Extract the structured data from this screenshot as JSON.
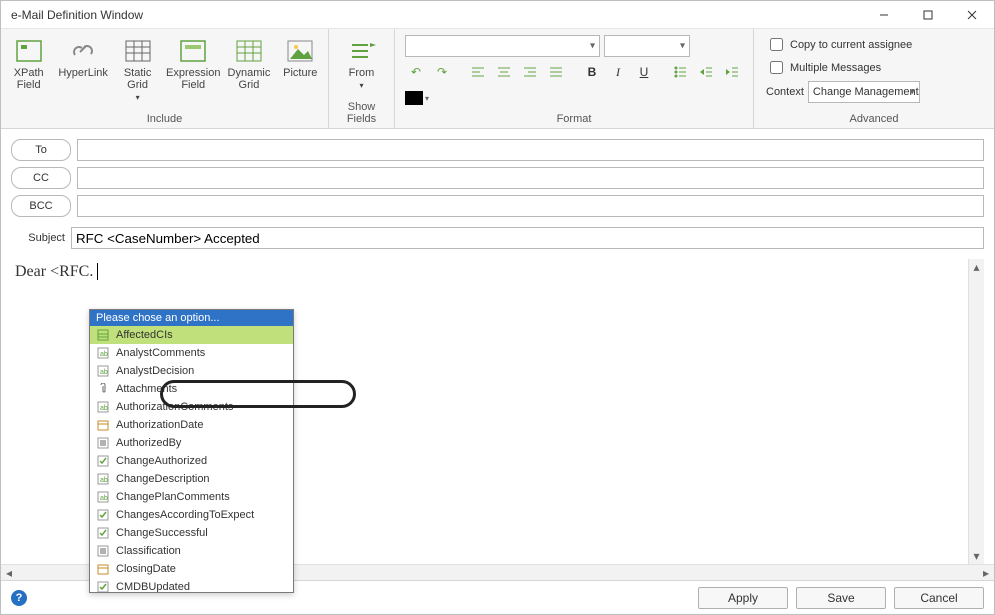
{
  "window": {
    "title": "e-Mail Definition Window"
  },
  "ribbon": {
    "include": {
      "label": "Include",
      "xpath": "XPath\nField",
      "hyperlink": "HyperLink",
      "staticgrid": "Static\nGrid",
      "exprfield": "Expression\nField",
      "dyngrid": "Dynamic\nGrid",
      "picture": "Picture"
    },
    "showfields": {
      "label": "Show Fields",
      "from": "From"
    },
    "format": {
      "label": "Format"
    },
    "advanced": {
      "label": "Advanced",
      "copy_assignee": "Copy to current assignee",
      "multiple_msgs": "Multiple Messages",
      "context_lbl": "Context",
      "context_val": "Change Management"
    }
  },
  "addr": {
    "to": "To",
    "cc": "CC",
    "bcc": "BCC"
  },
  "subject": {
    "label": "Subject",
    "value": "RFC <CaseNumber> Accepted"
  },
  "body": {
    "text": "Dear <RFC."
  },
  "dropdown": {
    "header": "Please chose an option...",
    "items": [
      "AffectedCIs",
      "AnalystComments",
      "AnalystDecision",
      "Attachments",
      "AuthorizationComments",
      "AuthorizationDate",
      "AuthorizedBy",
      "ChangeAuthorized",
      "ChangeDescription",
      "ChangePlanComments",
      "ChangesAccordingToExpect",
      "ChangeSuccessful",
      "Classification",
      "ClosingDate",
      "CMDBUpdated"
    ],
    "selected_index": 0
  },
  "buttons": {
    "apply": "Apply",
    "save": "Save",
    "cancel": "Cancel"
  }
}
